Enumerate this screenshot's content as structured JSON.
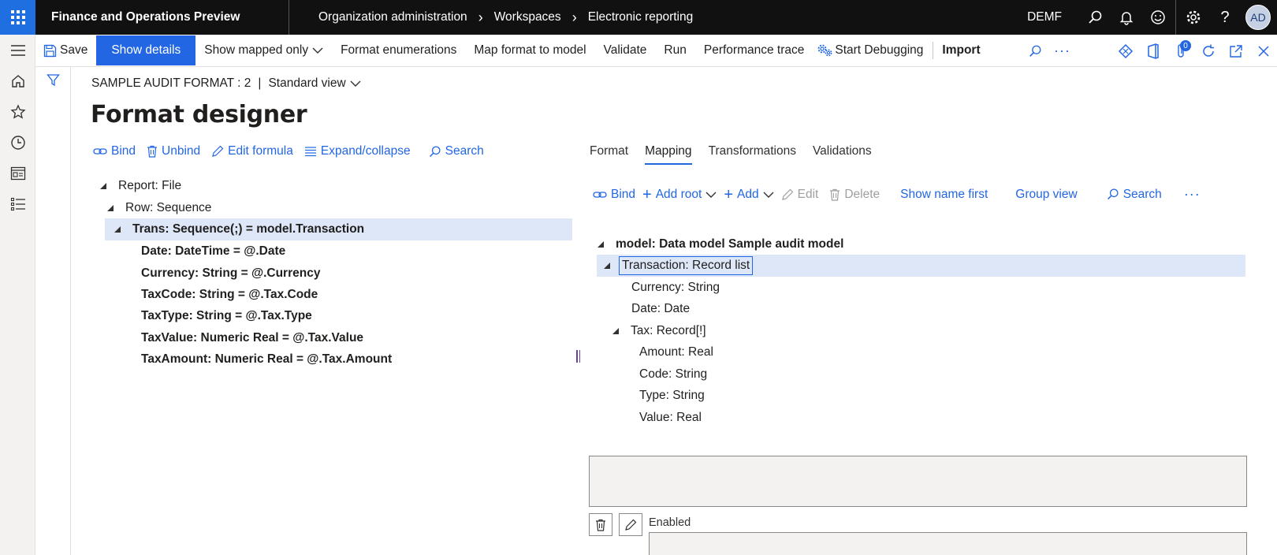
{
  "app": {
    "title": "Finance and Operations Preview"
  },
  "breadcrumb": [
    "Organization administration",
    "Workspaces",
    "Electronic reporting"
  ],
  "topbar": {
    "company": "DEMF",
    "avatar_initials": "AD"
  },
  "actionbar": {
    "save": "Save",
    "show_details": "Show details",
    "show_mapped_only": "Show mapped only",
    "format_enumerations": "Format enumerations",
    "map_format_to_model": "Map format to model",
    "validate": "Validate",
    "run": "Run",
    "performance_trace": "Performance trace",
    "start_debugging": "Start Debugging",
    "import": "Import",
    "attachments_count": "0"
  },
  "page": {
    "record": "SAMPLE AUDIT FORMAT : 2",
    "divider": "|",
    "view": "Standard view",
    "title": "Format designer"
  },
  "format_toolbar": {
    "bind": "Bind",
    "unbind": "Unbind",
    "edit_formula": "Edit formula",
    "expand_collapse": "Expand/collapse",
    "search": "Search"
  },
  "format_tree": [
    {
      "label": "Report: File",
      "bold": false,
      "expanded": true
    },
    {
      "label": "Row: Sequence",
      "bold": false,
      "expanded": true
    },
    {
      "label": "Trans: Sequence(;) = model.Transaction",
      "bold": true,
      "expanded": true,
      "selected": true
    },
    {
      "label": "Date: DateTime = @.Date",
      "bold": true
    },
    {
      "label": "Currency: String = @.Currency",
      "bold": true
    },
    {
      "label": "TaxCode: String = @.Tax.Code",
      "bold": true
    },
    {
      "label": "TaxType: String = @.Tax.Type",
      "bold": true
    },
    {
      "label": "TaxValue: Numeric Real = @.Tax.Value",
      "bold": true
    },
    {
      "label": "TaxAmount: Numeric Real = @.Tax.Amount",
      "bold": true
    }
  ],
  "tabs": {
    "format": "Format",
    "mapping": "Mapping",
    "transformations": "Transformations",
    "validations": "Validations",
    "active": "Mapping"
  },
  "mapping_toolbar": {
    "bind": "Bind",
    "add_root": "Add root",
    "add": "Add",
    "edit": "Edit",
    "delete": "Delete",
    "show_name_first": "Show name first",
    "group_view": "Group view",
    "search": "Search"
  },
  "model_tree": [
    {
      "label": "model: Data model Sample audit model",
      "bold": true,
      "expanded": true
    },
    {
      "label": "Transaction: Record list",
      "selected": true,
      "expanded": true
    },
    {
      "label": "Currency: String"
    },
    {
      "label": "Date: Date"
    },
    {
      "label": "Tax: Record[!]",
      "expanded": true
    },
    {
      "label": "Amount: Real"
    },
    {
      "label": "Code: String"
    },
    {
      "label": "Type: String"
    },
    {
      "label": "Value: Real"
    }
  ],
  "details": {
    "enabled_label": "Enabled"
  },
  "colors": {
    "accent": "#2266e3",
    "topbar": "#111111",
    "selection": "#dde7f8"
  }
}
